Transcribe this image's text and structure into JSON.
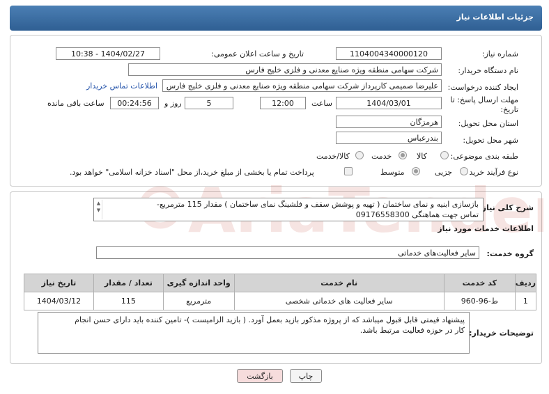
{
  "header": {
    "title": "جزئیات اطلاعات نیاز"
  },
  "fields": {
    "need_number": {
      "label": "شماره نیاز:",
      "value": "1104004340000120"
    },
    "public_date": {
      "label": "تاریخ و ساعت اعلان عمومی:",
      "value": "1404/02/27 - 10:38"
    },
    "buyer_org": {
      "label": "نام دستگاه خریدار:",
      "value": "شرکت سهامی منطقه ویژه صنایع معدنی و فلزی خلیج فارس"
    },
    "requester": {
      "label": "ایجاد کننده درخواست:",
      "value": "علیرضا صمیمی کارپرداز شرکت سهامی منطقه ویژه صنایع معدنی و فلزی خلیج فارس"
    },
    "buyer_contact_link": "اطلاعات تماس خریدار",
    "deadline": {
      "label_line1": "مهلت ارسال پاسخ: تا",
      "label_line2": "تاریخ:",
      "date": "1404/03/01",
      "time_label": "ساعت",
      "time": "12:00",
      "days": "5",
      "days_label": "روز و",
      "remaining": "00:24:56",
      "remaining_label": "ساعت باقی مانده"
    },
    "province": {
      "label": "استان محل تحویل:",
      "value": "هرمزگان"
    },
    "city": {
      "label": "شهر محل تحویل:",
      "value": "بندرعباس"
    },
    "category": {
      "label": "طبقه بندی موضوعی:",
      "options": [
        "کالا",
        "خدمت",
        "کالا/خدمت"
      ],
      "selected": "خدمت"
    },
    "process": {
      "label": "نوع فرآیند خرید :",
      "options": [
        "جزیی",
        "متوسط"
      ],
      "selected": "متوسط",
      "payment_note": "پرداخت تمام یا بخشی از مبلغ خرید،از محل \"اسناد خزانه اسلامی\" خواهد بود."
    }
  },
  "description": {
    "label": "شرح کلی نیاز:",
    "line1": "بازسازی ابنیه و نمای ساختمان ( تهیه و پوشش سقف و فلشینگ نمای ساختمان ) مقدار 115 مترمربع-",
    "line2": "تماس جهت هماهنگی 09176558300"
  },
  "services_section": {
    "title": "اطلاعات خدمات مورد نیاز",
    "group_label": "گروه خدمت:",
    "group_value": "سایر فعالیت‌های خدماتی"
  },
  "table": {
    "headers": [
      "ردیف",
      "کد خدمت",
      "نام خدمت",
      "واحد اندازه گیری",
      "تعداد / مقدار",
      "تاریخ نیاز"
    ],
    "rows": [
      [
        "1",
        "ط-96-960",
        "سایر فعالیت های خدماتی شخصی",
        "مترمربع",
        "115",
        "1404/03/12"
      ]
    ]
  },
  "buyer_notes": {
    "label": "توضیحات خریدار:",
    "line1": "پیشنهاد قیمتی قابل قبول میباشد که از پروژه مذکور بازید بعمل آورد. ( بازید الزامیست )- تامین کننده باید دارای حسن انجام",
    "line2": "کار در حوزه فعالیت مرتبط باشد."
  },
  "buttons": {
    "print": "چاپ",
    "back": "بازگشت"
  },
  "colors": {
    "header": "#3b6ea3",
    "link": "#1f4fa8",
    "back_button": "#f6dcdc",
    "print_button": "#f4f4f4"
  },
  "watermark": {
    "text": "AriaTender.neT"
  }
}
